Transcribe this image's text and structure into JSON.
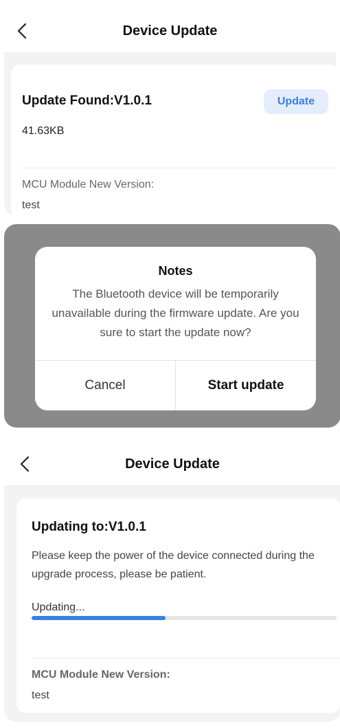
{
  "screen1": {
    "title": "Device Update",
    "back_icon": "chevron-left-icon",
    "update_found": "Update Found:V1.0.1",
    "file_size": "41.63KB",
    "update_button": "Update",
    "mcu_label": "MCU Module New Version:",
    "mcu_value": "test"
  },
  "dialog": {
    "title": "Notes",
    "message": "The Bluetooth device will be temporarily unavailable during the firmware update. Are you sure to start the update now?",
    "cancel": "Cancel",
    "confirm": "Start update"
  },
  "screen2": {
    "title": "Device Update",
    "back_icon": "chevron-left-icon",
    "updating_to": "Updating to:V1.0.1",
    "notice": "Please keep the power of the device connected during the upgrade process, please be patient.",
    "progress_label": "Updating...",
    "progress_percent": 44,
    "mcu_label": "MCU Module New Version:",
    "mcu_value": "test"
  },
  "colors": {
    "accent": "#3b7fe6",
    "button_bg": "#e4eefb",
    "overlay": "#8a8a8a",
    "background": "#f3f3f3"
  }
}
